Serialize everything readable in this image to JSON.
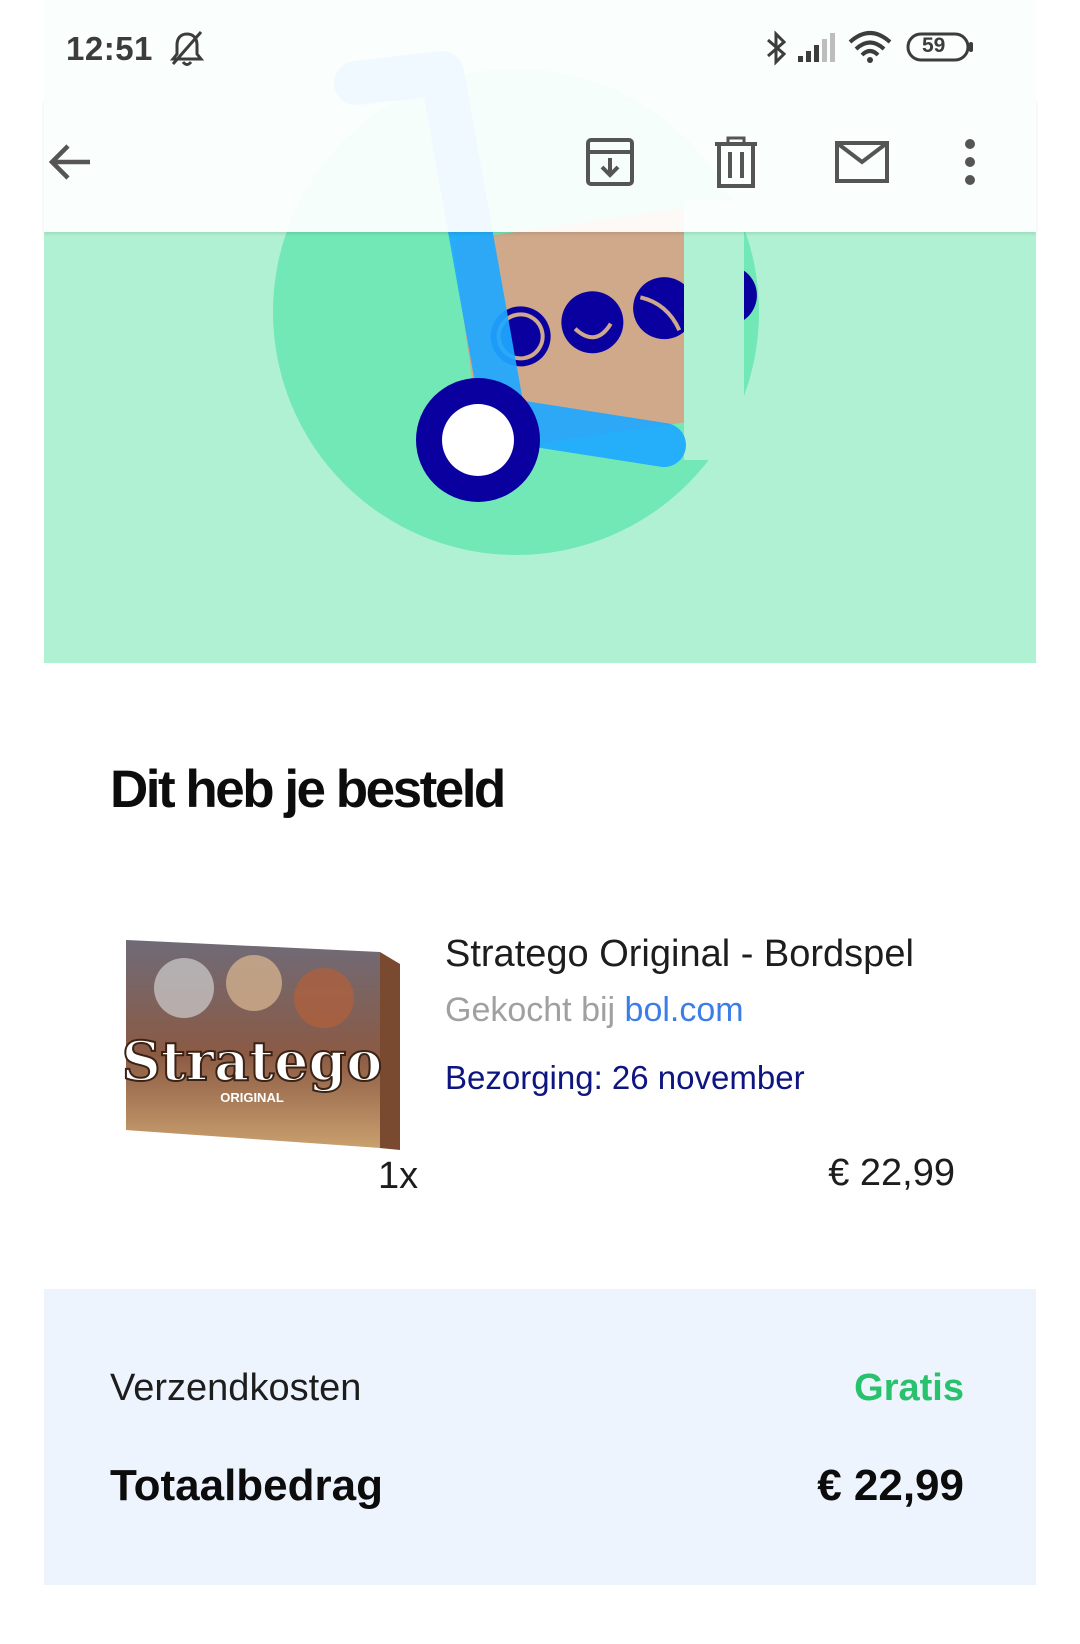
{
  "status_bar": {
    "time": "12:51",
    "battery": "59",
    "icons": [
      "bell-off-icon",
      "bluetooth-icon",
      "signal-icon",
      "wifi-icon",
      "battery-icon"
    ]
  },
  "toolbar": {
    "icons": [
      "back-arrow-icon",
      "archive-icon",
      "delete-icon",
      "mail-icon",
      "more-vert-icon"
    ]
  },
  "order": {
    "heading": "Dit heb je besteld",
    "product": {
      "name": "Stratego Original - Bordspel",
      "seller_prefix": "Gekocht bij",
      "seller": "bol.com",
      "delivery": "Bezorging: 26 november",
      "quantity": "1x",
      "price": "€ 22,99",
      "box_title": "Stratego",
      "box_subtitle": "ORIGINAL"
    },
    "summary": {
      "shipping_label": "Verzendkosten",
      "shipping_value": "Gratis",
      "total_label": "Totaalbedrag",
      "total_value": "€ 22,99"
    }
  },
  "colors": {
    "hero_bg": "#b0f1d3",
    "hero_circle": "#72e8b6",
    "accent_blue": "#1ea8ff",
    "dark_blue": "#0a00a0",
    "box_tan": "#cfa98a",
    "link": "#3d7ee6",
    "delivery": "#0e1581",
    "free_green": "#27c26b",
    "summary_bg": "#eef4fe"
  }
}
